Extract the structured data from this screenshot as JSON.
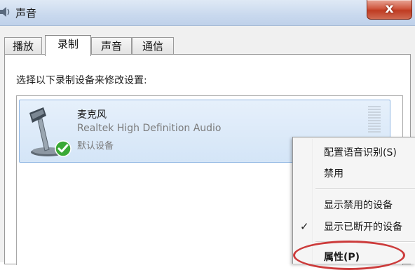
{
  "window": {
    "title": "声音",
    "close_label": "x"
  },
  "tabs": [
    {
      "label": "播放",
      "active": false
    },
    {
      "label": "录制",
      "active": true
    },
    {
      "label": "声音",
      "active": false
    },
    {
      "label": "通信",
      "active": false
    }
  ],
  "instruction": "选择以下录制设备来修改设置:",
  "device": {
    "name": "麦克风",
    "description": "Realtek High Definition Audio",
    "status": "默认设备",
    "icon": "microphone-icon",
    "badge_icon": "green-check-icon"
  },
  "context_menu": {
    "items": [
      {
        "label": "配置语音识别(S)",
        "checked": false
      },
      {
        "label": "禁用",
        "checked": false
      },
      {
        "label": "显示禁用的设备",
        "checked": false
      },
      {
        "label": "显示已断开的设备",
        "checked": true
      },
      {
        "label": "属性(P)",
        "checked": false,
        "bold": true
      }
    ],
    "check_glyph": "✓"
  },
  "colors": {
    "highlight_oval": "#cc3b3b",
    "selected_item": "#d4e5f7",
    "close_button": "#c94a31"
  }
}
